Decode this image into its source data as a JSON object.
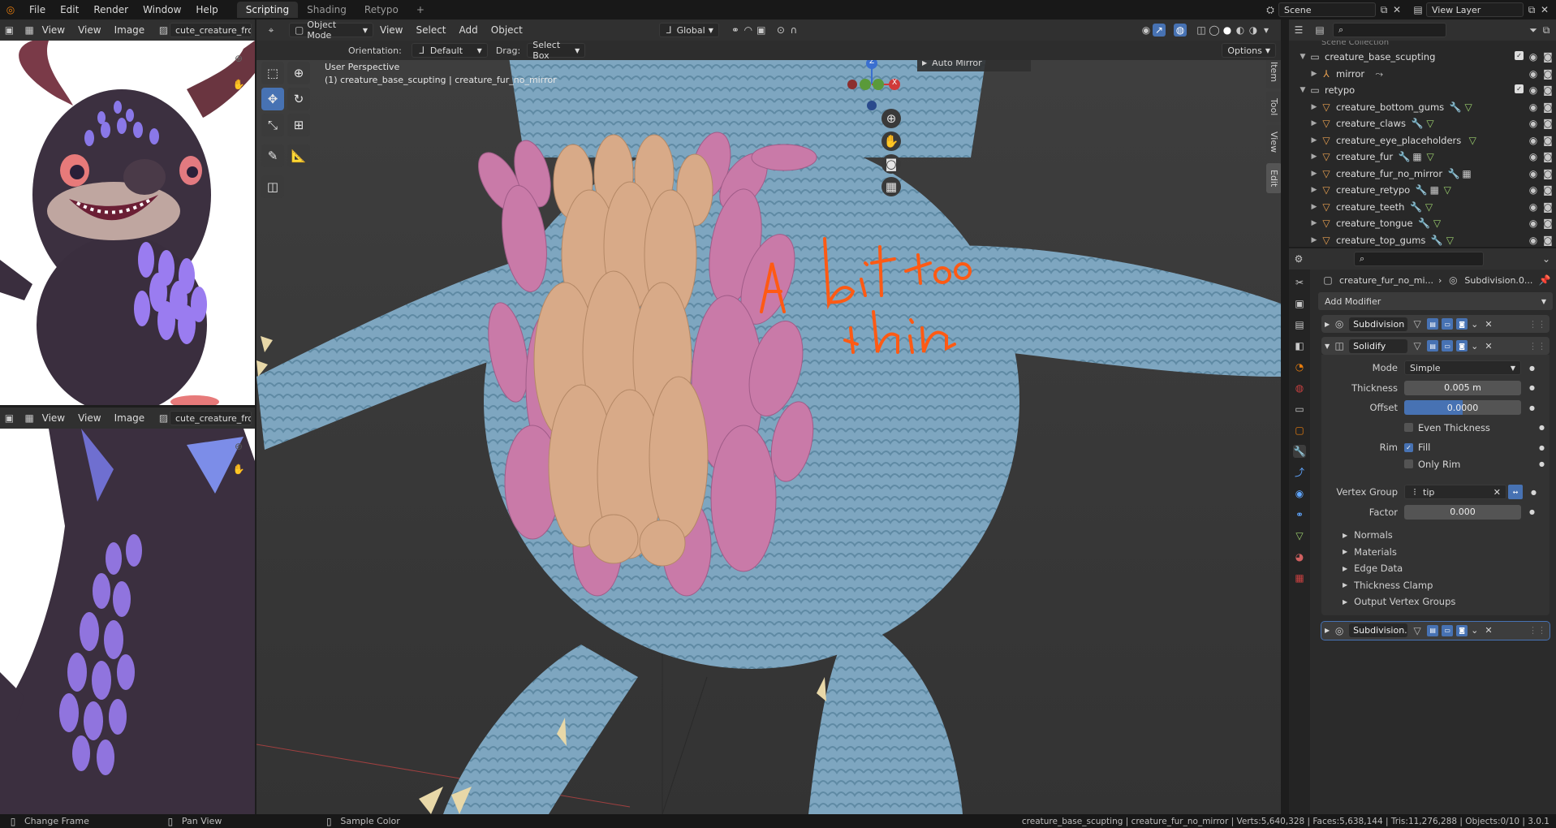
{
  "topbar": {
    "menus": [
      "File",
      "Edit",
      "Render",
      "Window",
      "Help"
    ],
    "workspaces": [
      "Scripting",
      "Shading",
      "Retypo"
    ],
    "active_workspace": "Scripting",
    "add_tab": "+",
    "scene": "Scene",
    "view_layer": "View Layer"
  },
  "image_editor_top": {
    "menus": [
      "View",
      "View",
      "Image"
    ],
    "image_name": "cute_creature_front_back"
  },
  "image_editor_bottom": {
    "menus": [
      "View",
      "View",
      "Image"
    ],
    "image_name": "cute_creature_front_back"
  },
  "viewport": {
    "mode": "Object Mode",
    "menus": [
      "View",
      "Select",
      "Add",
      "Object"
    ],
    "transform": "Global",
    "orientation_label": "Orientation:",
    "orientation_value": "Default",
    "drag_label": "Drag:",
    "drag_value": "Select Box",
    "options": "Options",
    "perspective": "User Perspective",
    "object_info": "(1) creature_base_scupting | creature_fur_no_mirror",
    "auto_mirror": "Auto Mirror",
    "side_tabs": [
      "Item",
      "Tool",
      "View",
      "Edit"
    ],
    "gizmo_axes": [
      "Z",
      "X"
    ],
    "annotation_color": "#ff5a14"
  },
  "outliner": {
    "header": "Scene Collection",
    "rows": [
      {
        "name": "creature_base_scupting",
        "kind": "collection",
        "depth": 0
      },
      {
        "name": "mirror",
        "kind": "object",
        "depth": 1
      },
      {
        "name": "retypo",
        "kind": "collection",
        "depth": 0
      },
      {
        "name": "creature_bottom_gums",
        "kind": "mesh",
        "depth": 1
      },
      {
        "name": "creature_claws",
        "kind": "mesh",
        "depth": 1
      },
      {
        "name": "creature_eye_placeholders",
        "kind": "mesh",
        "depth": 1
      },
      {
        "name": "creature_fur",
        "kind": "mesh",
        "depth": 1
      },
      {
        "name": "creature_fur_no_mirror",
        "kind": "mesh",
        "depth": 1
      },
      {
        "name": "creature_retypo",
        "kind": "mesh",
        "depth": 1
      },
      {
        "name": "creature_teeth",
        "kind": "mesh",
        "depth": 1
      },
      {
        "name": "creature_tongue",
        "kind": "mesh",
        "depth": 1
      },
      {
        "name": "creature_top_gums",
        "kind": "mesh",
        "depth": 1
      }
    ]
  },
  "properties": {
    "breadcrumb_object": "creature_fur_no_mi...",
    "breadcrumb_modifier": "Subdivision.0...",
    "add_modifier": "Add Modifier",
    "modifiers": [
      "Subdivision",
      "Solidify",
      "Subdivision.0..."
    ],
    "solidify": {
      "mode_label": "Mode",
      "mode_value": "Simple",
      "thickness_label": "Thickness",
      "thickness_value": "0.005 m",
      "offset_label": "Offset",
      "offset_value": "0.0000",
      "even_thickness": "Even Thickness",
      "rim_label": "Rim",
      "fill": "Fill",
      "only_rim": "Only Rim",
      "vgroup_label": "Vertex Group",
      "vgroup_value": "tip",
      "factor_label": "Factor",
      "factor_value": "0.000"
    },
    "subpanels": [
      "Normals",
      "Materials",
      "Edge Data",
      "Thickness Clamp",
      "Output Vertex Groups"
    ]
  },
  "statusbar": {
    "left": [
      {
        "icon": "mouse-left-icon",
        "label": "Change Frame"
      },
      {
        "icon": "mouse-middle-icon",
        "label": "Pan View"
      },
      {
        "icon": "mouse-right-icon",
        "label": "Sample Color"
      }
    ],
    "stats": "creature_base_scupting | creature_fur_no_mirror | Verts:5,640,328 | Faces:5,638,144 | Tris:11,276,288 | Objects:0/10 | 3.0.1"
  },
  "colors": {
    "accent": "#4772b3",
    "fur": "#7ea6c0",
    "pink_scales": "#c97aa8",
    "tan_scales": "#d8aa88"
  }
}
